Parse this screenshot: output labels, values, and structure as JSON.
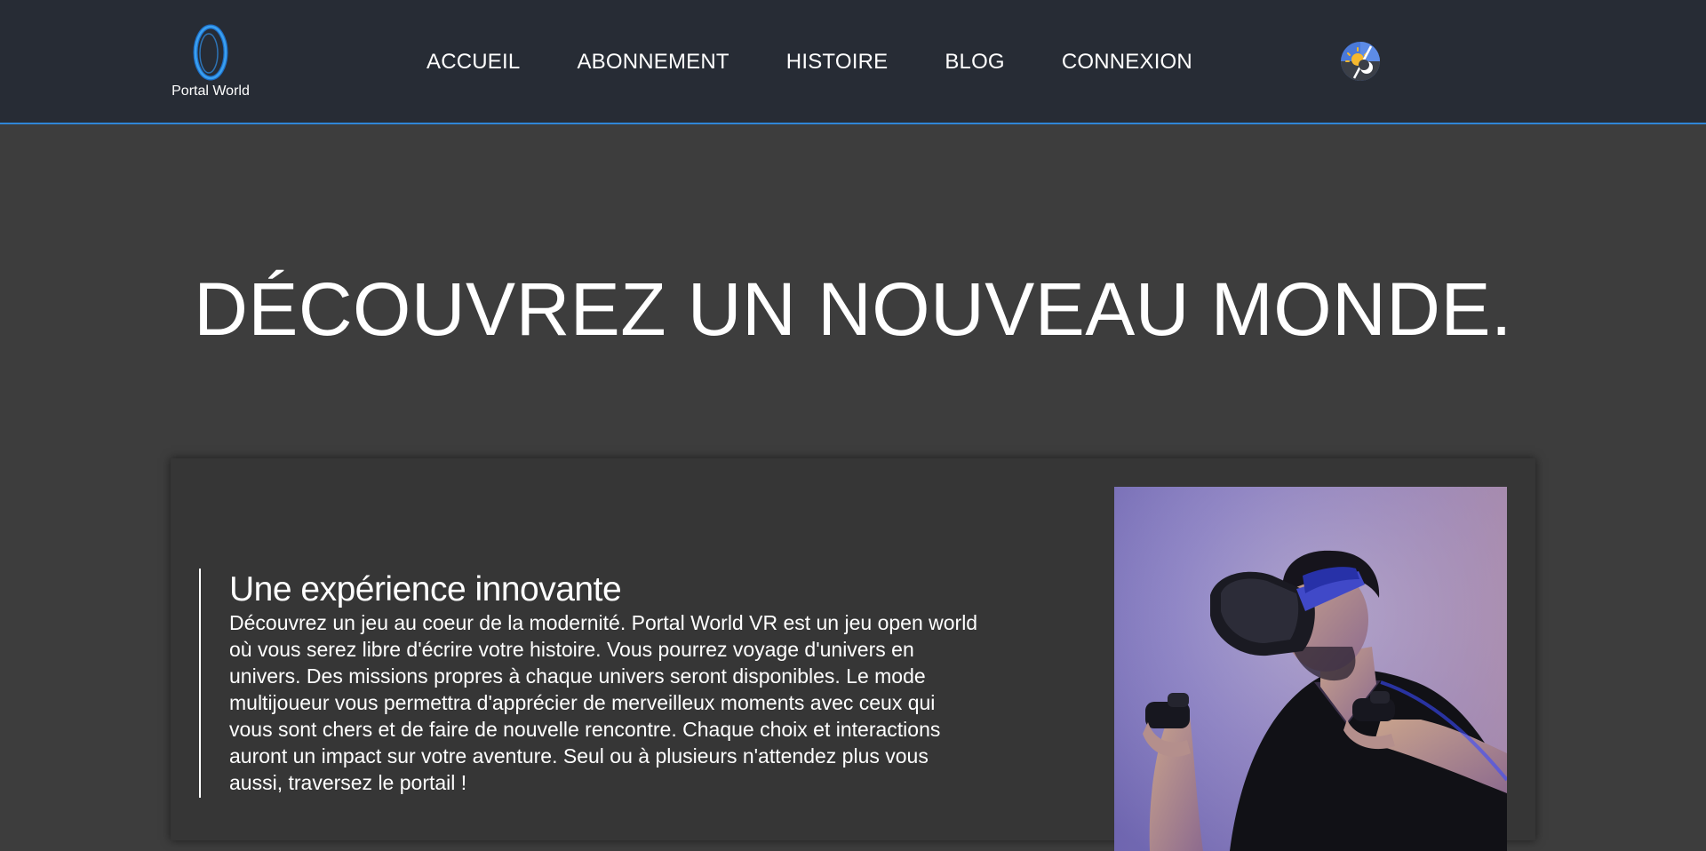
{
  "header": {
    "logo_text": "Portal World",
    "logo_icon": "portal-ring-icon",
    "nav": [
      {
        "label": "ACCUEIL"
      },
      {
        "label": "ABONNEMENT"
      },
      {
        "label": "HISTOIRE"
      },
      {
        "label": "BLOG"
      },
      {
        "label": "CONNEXION"
      }
    ],
    "theme_toggle_icon": "sun-moon-theme-icon"
  },
  "hero": {
    "title": "DÉCOUVREZ UN NOUVEAU MONDE."
  },
  "feature": {
    "heading": "Une expérience innovante",
    "body": "Découvrez un jeu au coeur de la modernité. Portal World VR est un jeu open world où vous serez libre d'écrire votre histoire. Vous pourrez voyage d'univers en univers. Des missions propres à chaque univers seront disponibles. Le mode multijoueur vous permettra d'apprécier de merveilleux moments avec ceux qui vous sont chers et de faire de nouvelle rencontre. Chaque choix et interactions auront un impact sur votre aventure. Seul ou à plusieurs n'attendez plus vous aussi, traversez le portail !",
    "image_subject": "vr-player-photo"
  },
  "colors": {
    "header_bg": "#272c35",
    "accent": "#2f86d6",
    "page_bg": "#3d3d3d",
    "card_bg": "#363636"
  }
}
